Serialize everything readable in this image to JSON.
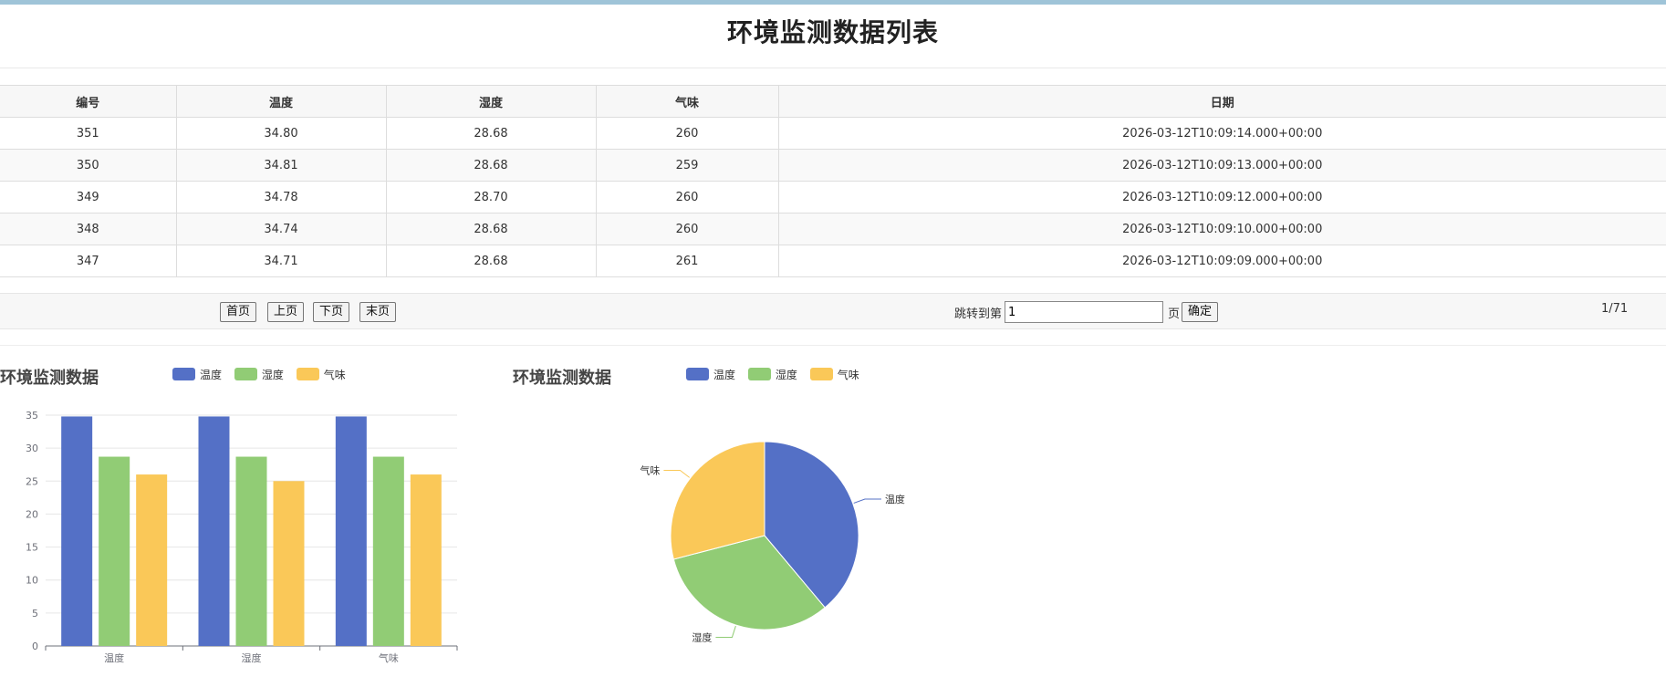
{
  "page_title": "环境监测数据列表",
  "table": {
    "columns": [
      "编号",
      "温度",
      "湿度",
      "气味",
      "日期"
    ],
    "rows": [
      [
        "351",
        "34.80",
        "28.68",
        "260",
        "2026-03-12T10:09:14.000+00:00"
      ],
      [
        "350",
        "34.81",
        "28.68",
        "259",
        "2026-03-12T10:09:13.000+00:00"
      ],
      [
        "349",
        "34.78",
        "28.70",
        "260",
        "2026-03-12T10:09:12.000+00:00"
      ],
      [
        "348",
        "34.74",
        "28.68",
        "260",
        "2026-03-12T10:09:10.000+00:00"
      ],
      [
        "347",
        "34.71",
        "28.68",
        "261",
        "2026-03-12T10:09:09.000+00:00"
      ]
    ]
  },
  "pager": {
    "first_label": "首页",
    "prev_label": "上页",
    "next_label": "下页",
    "last_label": "末页",
    "jump_label": "跳转到第",
    "jump_value": "1",
    "jump_suffix": "页",
    "confirm_label": "确定",
    "page_count": "1/71"
  },
  "colors": {
    "temperature": "#5470c6",
    "humidity": "#91cc75",
    "smell": "#fac858"
  },
  "chart_data": [
    {
      "type": "bar",
      "title": "环境监测数据",
      "legend": [
        "温度",
        "湿度",
        "气味"
      ],
      "legend_position": "top",
      "categories": [
        "温度",
        "湿度",
        "气味"
      ],
      "series": [
        {
          "name": "温度",
          "values": [
            34.8,
            34.8,
            34.8
          ]
        },
        {
          "name": "湿度",
          "values": [
            28.7,
            28.7,
            28.7
          ]
        },
        {
          "name": "气味",
          "values": [
            26,
            25,
            26
          ]
        }
      ],
      "yticks": [
        "0",
        "5",
        "10",
        "15",
        "20",
        "25",
        "30",
        "35"
      ],
      "ylim": [
        0,
        35
      ],
      "grid": true
    },
    {
      "type": "pie",
      "title": "环境监测数据",
      "legend": [
        "温度",
        "湿度",
        "气味"
      ],
      "legend_position": "top",
      "slices": [
        {
          "name": "温度",
          "value": 34.8
        },
        {
          "name": "湿度",
          "value": 28.68
        },
        {
          "name": "气味",
          "value": 26.0
        }
      ]
    }
  ]
}
